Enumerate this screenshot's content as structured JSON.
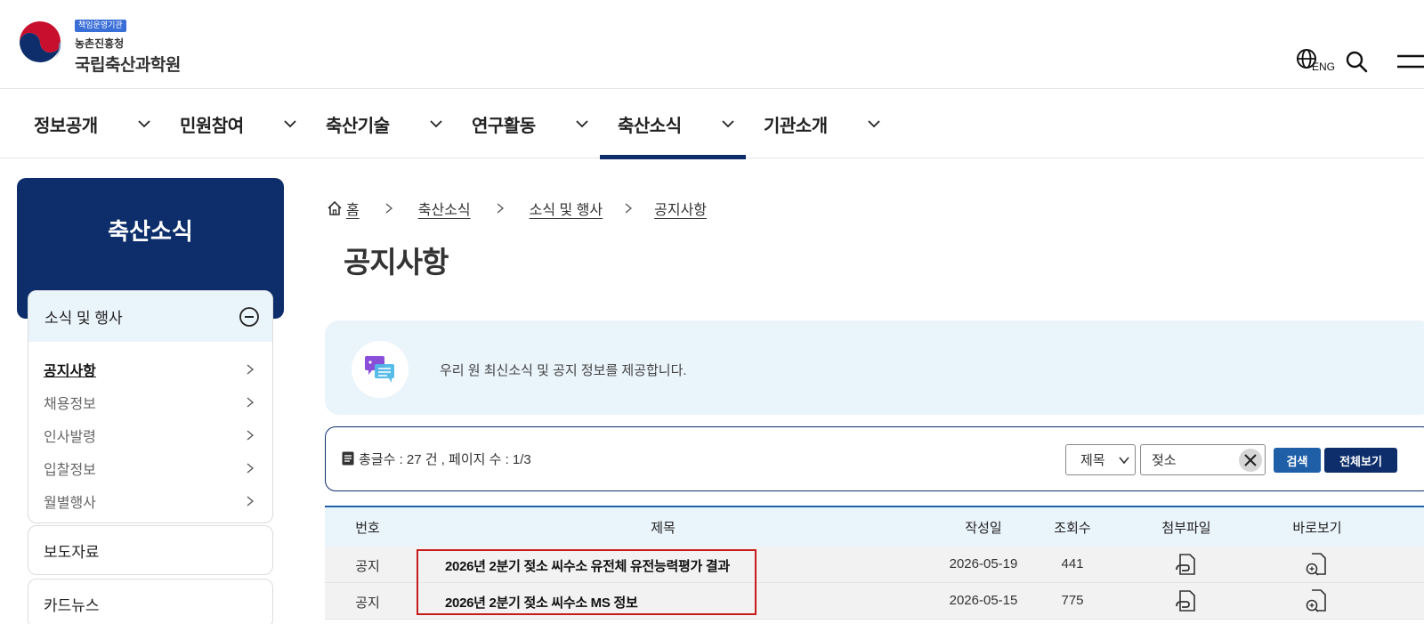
{
  "header": {
    "badge": "책임운영기관",
    "org_small": "농촌진흥청",
    "org_name": "국립축산과학원",
    "lang_label": "ENG"
  },
  "gnb": {
    "items": [
      {
        "label": "정보공개"
      },
      {
        "label": "민원참여"
      },
      {
        "label": "축산기술"
      },
      {
        "label": "연구활동"
      },
      {
        "label": "축산소식"
      },
      {
        "label": "기관소개"
      }
    ],
    "active_index": 4
  },
  "sidebar": {
    "title": "축산소식",
    "section": "소식 및 행사",
    "items": [
      {
        "label": "공지사항"
      },
      {
        "label": "채용정보"
      },
      {
        "label": "인사발령"
      },
      {
        "label": "입찰정보"
      },
      {
        "label": "월별행사"
      }
    ],
    "other_sections": [
      {
        "label": "보도자료"
      },
      {
        "label": "카드뉴스"
      }
    ]
  },
  "breadcrumb": {
    "home": "홈",
    "level1": "축산소식",
    "level2": "소식 및 행사",
    "level3": "공지사항"
  },
  "page_title": "공지사항",
  "info": {
    "text": "우리 원 최신소식 및 공지 정보를 제공합니다."
  },
  "search": {
    "count_text": "총글수 : 27 건 , 페이지 수 : 1/3",
    "select_value": "제목",
    "query": "젖소",
    "search_label": "검색",
    "view_all_label": "전체보기"
  },
  "table": {
    "headers": [
      "번호",
      "제목",
      "작성일",
      "조회수",
      "첨부파일",
      "바로보기"
    ],
    "rows": [
      {
        "no": "공지",
        "title": "2026년 2분기 젖소 씨수소 유전체 유전능력평가 결과",
        "date": "2026-05-19",
        "views": "441"
      },
      {
        "no": "공지",
        "title": "2026년 2분기 젖소 씨수소 MS 정보",
        "date": "2026-05-15",
        "views": "775"
      }
    ]
  },
  "colors": {
    "navy": "#0d2e6b",
    "blue": "#1f5fa8",
    "light_blue": "#eaf4fb",
    "highlight": "#c71a1a"
  }
}
